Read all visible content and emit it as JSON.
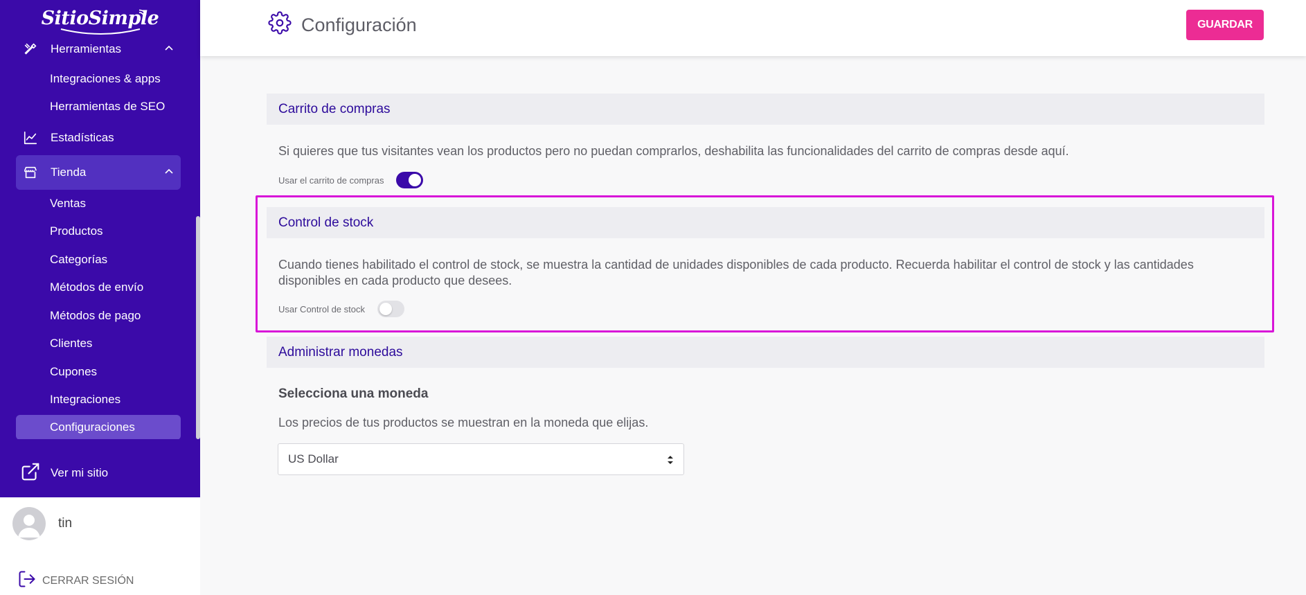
{
  "brand": {
    "logo_text": "SitioSimple",
    "primary": "#3b0aa9",
    "accent": "#ec2c94",
    "highlight": "#d815d8"
  },
  "sidebar": {
    "partial_item": {
      "label": "Herramientas",
      "icon": "tools-icon"
    },
    "tools_subitems": [
      {
        "label": "Integraciones & apps"
      },
      {
        "label": "Herramientas de SEO"
      }
    ],
    "stats": {
      "label": "Estadísticas",
      "icon": "chart-line-icon"
    },
    "store": {
      "label": "Tienda",
      "icon": "store-icon",
      "expanded": true
    },
    "store_subitems": [
      {
        "label": "Ventas"
      },
      {
        "label": "Productos"
      },
      {
        "label": "Categorías"
      },
      {
        "label": "Métodos de envío"
      },
      {
        "label": "Métodos de pago"
      },
      {
        "label": "Clientes"
      },
      {
        "label": "Cupones"
      },
      {
        "label": "Integraciones"
      },
      {
        "label": "Configuraciones",
        "current": true
      }
    ],
    "view_site": {
      "label": "Ver mi sitio",
      "icon": "external-link-icon"
    },
    "user": {
      "name": "tin"
    },
    "logout": {
      "label": "CERRAR SESIÓN",
      "icon": "logout-icon"
    }
  },
  "header": {
    "title": "Configuración",
    "icon": "gear-icon",
    "save_label": "GUARDAR"
  },
  "sections": {
    "cart": {
      "title": "Carrito de compras",
      "description": "Si quieres que tus visitantes vean los productos pero no puedan comprarlos, deshabilita las funcionalidades del carrito de compras desde aquí.",
      "toggle_label": "Usar el carrito de compras",
      "toggle_on": true
    },
    "stock": {
      "title": "Control de stock",
      "description": "Cuando tienes habilitado el control de stock, se muestra la cantidad de unidades disponibles de cada producto. Recuerda habilitar el control de stock y las cantidades disponibles en cada producto que desees.",
      "toggle_label": "Usar Control de stock",
      "toggle_on": false
    },
    "currency": {
      "title": "Administrar monedas",
      "subtitle": "Selecciona una moneda",
      "description": "Los precios de tus productos se muestran en la moneda que elijas.",
      "selected": "US Dollar"
    }
  }
}
